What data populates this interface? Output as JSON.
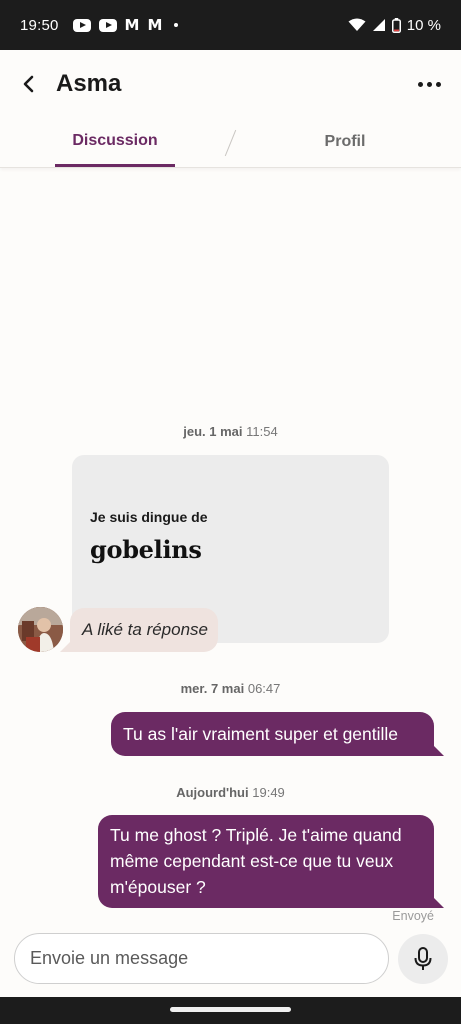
{
  "status_bar": {
    "time": "19:50",
    "battery": "10 %"
  },
  "header": {
    "title": "Asma"
  },
  "tabs": [
    {
      "label": "Discussion"
    },
    {
      "label": "Profil"
    }
  ],
  "chat": {
    "day1": {
      "day": "jeu. 1 mai",
      "time": "11:54"
    },
    "prompt": {
      "question": "Je suis dingue de",
      "answer": "gobelins"
    },
    "liked_label": "A liké ta réponse",
    "day2": {
      "day": "mer. 7 mai",
      "time": "06:47"
    },
    "message1": "Tu as l'air vraiment super et gentille",
    "day3": {
      "day": "Aujourd'hui",
      "time": "19:49"
    },
    "message2": "Tu me ghost ? Triplé. Je t'aime quand même cependant est-ce que tu veux m'épouser ?",
    "sent_status": "Envoyé"
  },
  "composer": {
    "placeholder": "Envoie un message"
  },
  "colors": {
    "accent": "#6b2a63",
    "liked_bg": "#efe3df",
    "card_bg": "#ececec"
  }
}
